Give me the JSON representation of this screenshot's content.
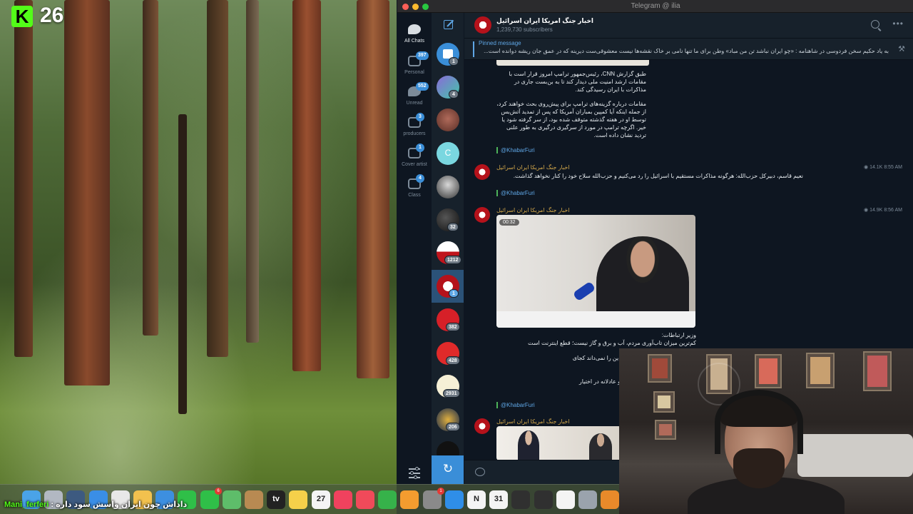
{
  "stream": {
    "logo_letter": "K",
    "viewer_count": "26",
    "chat_user": "Mani_ferferi",
    "chat_separator": " : ",
    "chat_message": "داداش چون ایران واسش سود داره"
  },
  "window": {
    "title": "Telegram @ ilia"
  },
  "folders": [
    {
      "label": "All Chats",
      "badge": "",
      "icon": "chat-bubbles-icon"
    },
    {
      "label": "Personal",
      "badge": "397",
      "icon": "folder-icon"
    },
    {
      "label": "Unread",
      "badge": "552",
      "icon": "unread-chat-icon"
    },
    {
      "label": "producers",
      "badge": "3",
      "icon": "folder-icon"
    },
    {
      "label": "Cover artist",
      "badge": "1",
      "icon": "folder-icon"
    },
    {
      "label": "Class",
      "badge": "4",
      "icon": "folder-icon"
    }
  ],
  "chat_list_badges": [
    "1",
    "4",
    "32",
    "1212",
    "1",
    "382",
    "428",
    "2931",
    "206"
  ],
  "channel": {
    "name": "اخبار جنگ امریکا ایران اسرائیل",
    "subscribers": "1,239,730 subscribers"
  },
  "pinned": {
    "label": "Pinned message",
    "text": "به یاد حکیم سخن فردوسی در شاهنامه : «چو ایران نباشد تن من مباد» وطن برای ما تنها نامی بر خاک نقشه‌ها نیست معشوقی‌ست دیرینه که در عمق جان ریشه دوانده است..."
  },
  "messages": [
    {
      "paragraph_1": "طبق گزارش CNN، رئیس‌جمهور ترامپ امروز قرار است با مقامات ارشد امنیت ملی دیدار کند تا به بن‌بست جاری در مذاکرات با ایران رسیدگی کند.",
      "paragraph_2": "مقامات درباره گزینه‌های ترامپ برای پیش‌روی بحث خواهند کرد، از جمله اینکه آیا کمپین بمباران آمریکا که پس از تمدید آتش‌بس توسط او در هفته گذشته متوقف شده بود، از سر گرفته شود یا خیر. اگرچه ترامپ در مورد از سرگیری درگیری به طور علنی تردید نشان داده است.",
      "signature": "@KhabarFuri"
    },
    {
      "sender": "اخبار جنگ امریکا ایران اسرائیل",
      "text": "نعیم قاسم، دبیرکل حزب‌الله: هرگونه مذاکرات مستقیم با اسرائیل را رد می‌کنیم و حزب‌الله سلاح خود را کنار نخواهد گذاشت.",
      "views": "14.1K",
      "time": "8:55 AM",
      "signature": "@KhabarFuri"
    },
    {
      "sender": "اخبار جنگ امریکا ایران اسرائیل",
      "media_duration": "00:32",
      "views": "14.9K",
      "time": "8:56 AM",
      "line_1": "وزیر ارتباطات:",
      "line_2": "کم‌ترین میزان تاب‌آوری مردم، آب و برق و گاز نیست؛ قطع اینترنت است",
      "line_3": "کشور نیاز به اینترنت نداریم! آدم این را نمی‌داند کجای",
      "line_4": "تم که اینترنت برگردد و با کیفیت و عادلانه در اختیار",
      "signature": "@KhabarFuri"
    },
    {
      "sender": "اخبار جنگ امریکا ایران اسرائیل"
    }
  ],
  "dock_apps": [
    {
      "icon": "finder-icon",
      "color": "#4aa3e8",
      "label": "",
      "badge": ""
    },
    {
      "icon": "launchpad-icon",
      "color": "#b2b8c2",
      "label": "",
      "badge": ""
    },
    {
      "icon": "quicktime-icon",
      "color": "#3d5a80",
      "label": "",
      "badge": ""
    },
    {
      "icon": "safari-icon",
      "color": "#3a8ee6",
      "label": "",
      "badge": ""
    },
    {
      "icon": "chrome-icon",
      "color": "#e8e8e8",
      "label": "",
      "badge": ""
    },
    {
      "icon": "photos-icon",
      "color": "#f2c14e",
      "label": "",
      "badge": ""
    },
    {
      "icon": "mail-icon",
      "color": "#3d8fe0",
      "label": "",
      "badge": ""
    },
    {
      "icon": "facetime-icon",
      "color": "#2fbf48",
      "label": "",
      "badge": ""
    },
    {
      "icon": "messages-icon",
      "color": "#2fbf48",
      "label": "",
      "badge": "6"
    },
    {
      "icon": "maps-icon",
      "color": "#5ebd6a",
      "label": "",
      "badge": ""
    },
    {
      "icon": "archive-icon",
      "color": "#b88a52",
      "label": "",
      "badge": ""
    },
    {
      "icon": "appletv-icon",
      "color": "#222222",
      "label": "tv",
      "badge": ""
    },
    {
      "icon": "notes-icon",
      "color": "#f5d04a",
      "label": "",
      "badge": ""
    },
    {
      "icon": "calendar-icon",
      "color": "#f4f4f4",
      "label": "27",
      "badge": ""
    },
    {
      "icon": "music-icon",
      "color": "#f0425e",
      "label": "",
      "badge": ""
    },
    {
      "icon": "news-icon",
      "color": "#f04a5a",
      "label": "",
      "badge": ""
    },
    {
      "icon": "numbers-icon",
      "color": "#36b24a",
      "label": "",
      "badge": ""
    },
    {
      "icon": "pages-icon",
      "color": "#f39c2f",
      "label": "",
      "badge": ""
    },
    {
      "icon": "system-settings-icon",
      "color": "#8a8a8a",
      "label": "",
      "badge": "1"
    },
    {
      "icon": "app-store-icon",
      "color": "#2f8ee8",
      "label": "",
      "badge": ""
    },
    {
      "icon": "notion-icon",
      "color": "#f4f4f4",
      "label": "N",
      "badge": ""
    },
    {
      "icon": "calendar-31-icon",
      "color": "#f4f4f4",
      "label": "31",
      "badge": ""
    },
    {
      "icon": "logic-pro-icon",
      "color": "#303030",
      "label": "",
      "badge": ""
    },
    {
      "icon": "audio-app-icon",
      "color": "#303030",
      "label": "",
      "badge": ""
    },
    {
      "icon": "cube-app-icon",
      "color": "#f4f4f4",
      "label": "",
      "badge": ""
    },
    {
      "icon": "disk-utility-icon",
      "color": "#9aa3ad",
      "label": "",
      "badge": ""
    },
    {
      "icon": "fl-studio-icon",
      "color": "#e88a2a",
      "label": "",
      "badge": ""
    }
  ],
  "colors": {
    "accent": "#5fa7e6",
    "sender": "#d5a94b",
    "brand_green": "#53fc18"
  }
}
